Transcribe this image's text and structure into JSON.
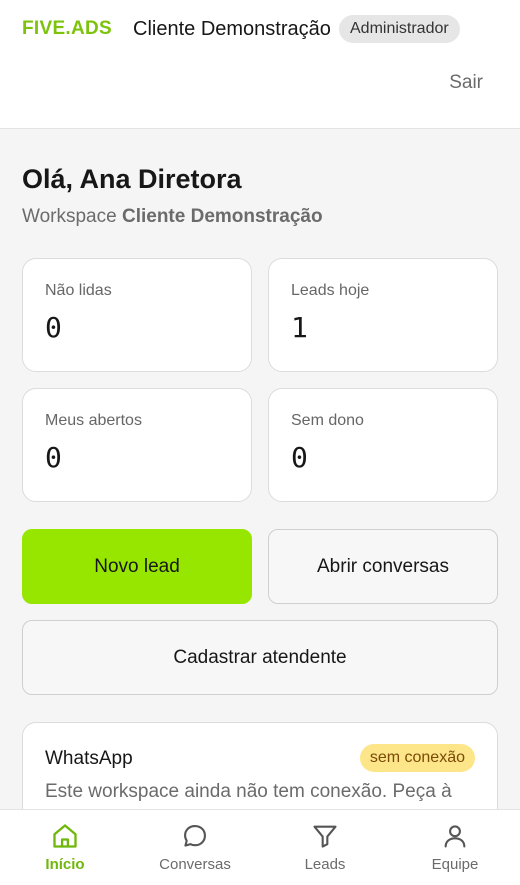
{
  "header": {
    "brand": "FIVE.ADS",
    "client_name": "Cliente Demonstração",
    "role_badge": "Administrador",
    "logout_label": "Sair"
  },
  "greeting": "Olá, Ana Diretora",
  "workspace": {
    "prefix": "Workspace",
    "name": "Cliente Demonstração"
  },
  "stats": [
    {
      "label": "Não lidas",
      "value": "0"
    },
    {
      "label": "Leads hoje",
      "value": "1"
    },
    {
      "label": "Meus abertos",
      "value": "0"
    },
    {
      "label": "Sem dono",
      "value": "0"
    }
  ],
  "actions": {
    "new_lead": "Novo lead",
    "open_conversations": "Abrir conversas",
    "register_agent": "Cadastrar atendente"
  },
  "whatsapp": {
    "title": "WhatsApp",
    "status": "sem conexão",
    "description": "Este workspace ainda não tem conexão. Peça à"
  },
  "nav": {
    "items": [
      {
        "label": "Início",
        "icon": "home-icon",
        "active": true
      },
      {
        "label": "Conversas",
        "icon": "chat-icon",
        "active": false
      },
      {
        "label": "Leads",
        "icon": "filter-icon",
        "active": false
      },
      {
        "label": "Equipe",
        "icon": "user-icon",
        "active": false
      }
    ]
  },
  "colors": {
    "brand": "#7dc30c",
    "primary_button": "#96e600",
    "warning_badge": "#fde68a",
    "active_nav": "#6fb70a"
  }
}
